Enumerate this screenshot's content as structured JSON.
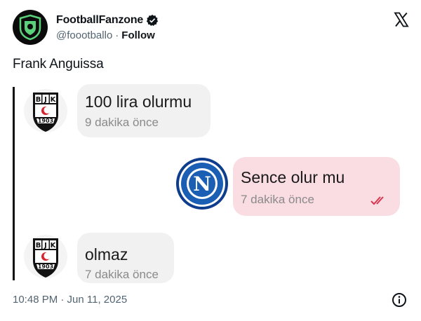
{
  "author": {
    "display_name": "FootballFanzone",
    "handle": "@foootballo",
    "separator": "·",
    "follow_label": "Follow"
  },
  "tweet": {
    "text": "Frank Anguissa",
    "timestamp": "10:48 PM · Jun 11, 2025"
  },
  "chat": {
    "messages": [
      {
        "side": "left",
        "sender": "bjk",
        "text": "100 lira olurmu",
        "time": "9 dakika önce"
      },
      {
        "side": "right",
        "sender": "napoli",
        "text": "Sence olur mu",
        "time": "7 dakika önce",
        "status": "double-check"
      },
      {
        "side": "left",
        "sender": "bjk",
        "text": "olmaz",
        "time": "7 dakika önce"
      }
    ],
    "crest_letters": {
      "b": "B",
      "j": "J",
      "k": "K",
      "year": "1903",
      "napoli": "N"
    }
  },
  "icons": {
    "verified": "verified-badge-icon",
    "x_logo": "x-logo-icon",
    "info": "info-icon",
    "read_ticks": "double-check-icon"
  },
  "colors": {
    "text": "#0f1419",
    "muted": "#536471",
    "left_bubble": "#f1f1f1",
    "right_bubble": "#f9dde3",
    "napoli_blue": "#1a5fb4",
    "read_tick": "#d9364f"
  }
}
